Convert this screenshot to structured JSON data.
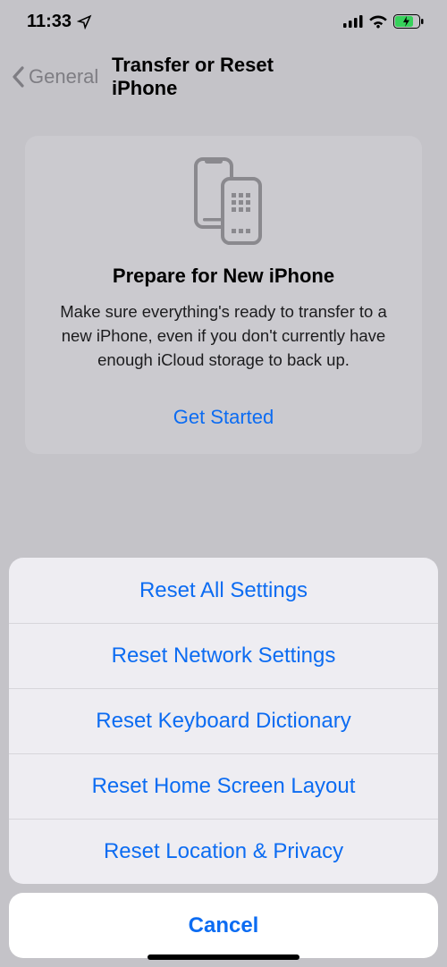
{
  "status": {
    "time": "11:33"
  },
  "nav": {
    "back_label": "General",
    "title": "Transfer or Reset iPhone"
  },
  "card": {
    "title": "Prepare for New iPhone",
    "body": "Make sure everything's ready to transfer to a new iPhone, even if you don't currently have enough iCloud storage to back up.",
    "cta": "Get Started"
  },
  "sheet": {
    "items": [
      "Reset All Settings",
      "Reset Network Settings",
      "Reset Keyboard Dictionary",
      "Reset Home Screen Layout",
      "Reset Location & Privacy"
    ],
    "cancel": "Cancel"
  }
}
